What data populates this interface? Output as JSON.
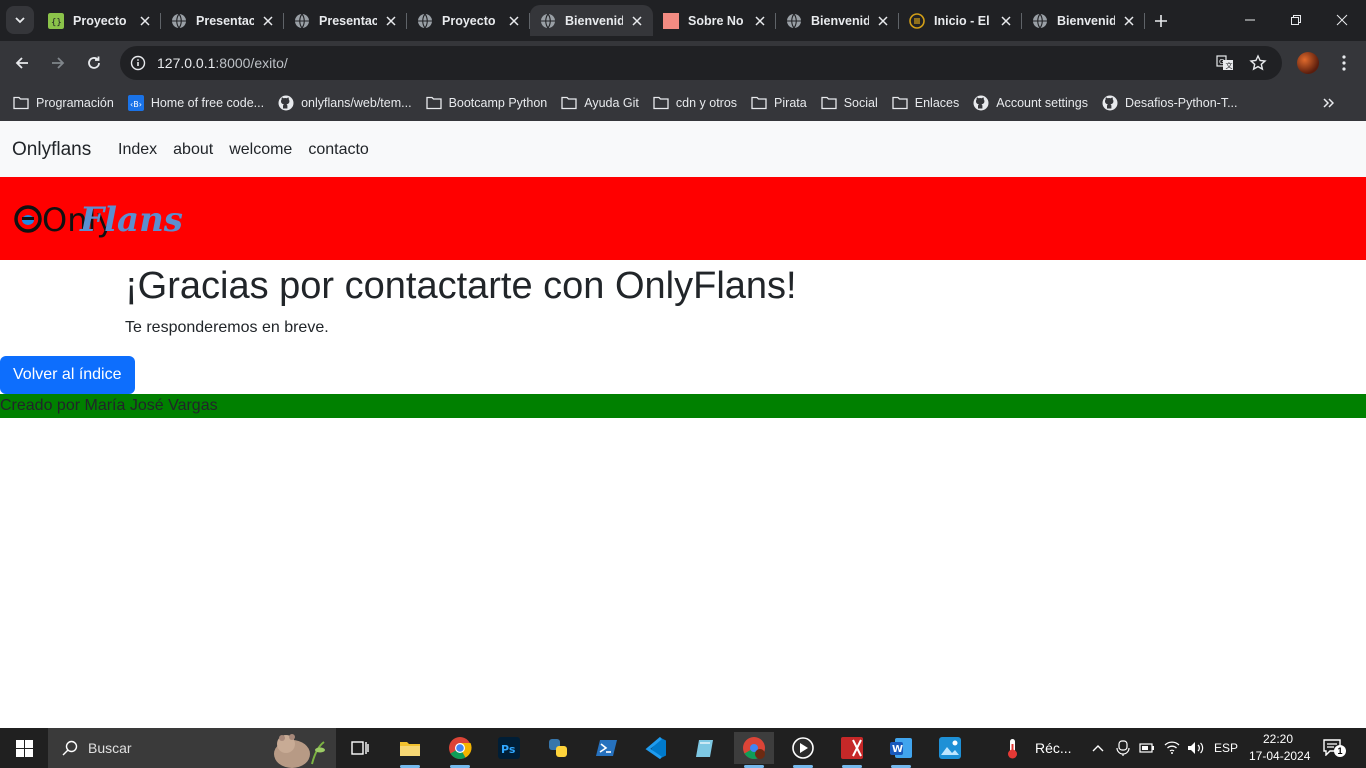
{
  "browser": {
    "tabs": [
      {
        "title": "Proyecto",
        "favicon": "code-file-icon",
        "color": "#8bc34a"
      },
      {
        "title": "Presentac",
        "favicon": "globe-icon",
        "color": "#9aa0a6"
      },
      {
        "title": "Presentac",
        "favicon": "globe-icon",
        "color": "#9aa0a6"
      },
      {
        "title": "Proyecto",
        "favicon": "globe-icon",
        "color": "#9aa0a6"
      },
      {
        "title": "Bienvenid",
        "favicon": "globe-icon",
        "color": "#9aa0a6",
        "active": true
      },
      {
        "title": "Sobre No",
        "favicon": "pink-square-icon",
        "color": "#f28b82"
      },
      {
        "title": "Bienvenid",
        "favicon": "globe-icon",
        "color": "#9aa0a6"
      },
      {
        "title": "Inicio - El",
        "favicon": "coin-icon",
        "color": "#d4a017"
      },
      {
        "title": "Bienvenid",
        "favicon": "globe-icon",
        "color": "#9aa0a6"
      }
    ],
    "address": {
      "host": "127.0.0.1",
      "path": ":8000/exito/"
    },
    "bookmarks": [
      {
        "label": "Programación",
        "icon": "folder-icon"
      },
      {
        "label": "Home of free code...",
        "icon": "bootstrap-icon"
      },
      {
        "label": "onlyflans/web/tem...",
        "icon": "github-icon"
      },
      {
        "label": "Bootcamp Python",
        "icon": "folder-icon"
      },
      {
        "label": "Ayuda Git",
        "icon": "folder-icon"
      },
      {
        "label": "cdn y otros",
        "icon": "folder-icon"
      },
      {
        "label": "Pirata",
        "icon": "folder-icon"
      },
      {
        "label": "Social",
        "icon": "folder-icon"
      },
      {
        "label": "Enlaces",
        "icon": "folder-icon"
      },
      {
        "label": "Account settings",
        "icon": "github-icon"
      },
      {
        "label": "Desafios-Python-T...",
        "icon": "github-icon"
      }
    ]
  },
  "site": {
    "brand": "Onlyflans",
    "nav": [
      "Index",
      "about",
      "welcome",
      "contacto"
    ],
    "logo_text_only": "Only",
    "logo_text_flans": "Flans",
    "heading": "¡Gracias por contactarte con OnlyFlans!",
    "message": "Te responderemos en breve.",
    "button": "Volver al índice",
    "footer": "Creado por María José Vargas",
    "colors": {
      "hero": "#ff0000",
      "footer": "#008000",
      "button": "#0d6efd",
      "navbar": "#f8f9fa"
    }
  },
  "taskbar": {
    "search_placeholder": "Buscar",
    "weather": "Réc...",
    "language": "ESP",
    "time": "22:20",
    "date": "17-04-2024",
    "notifications": "1"
  }
}
